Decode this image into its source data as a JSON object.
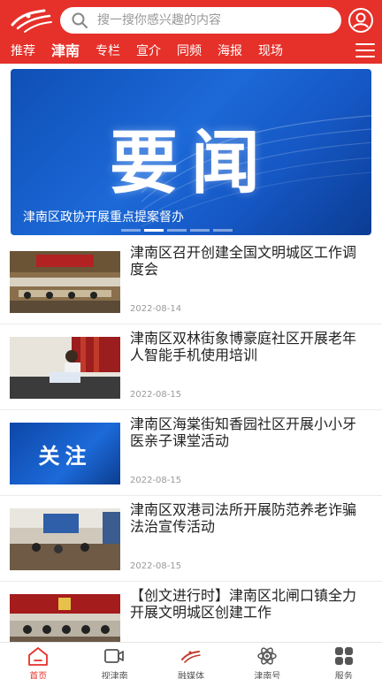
{
  "colors": {
    "brand": "#e5312a",
    "banner": "#1557c4"
  },
  "search": {
    "placeholder": "搜一搜你感兴趣的内容"
  },
  "nav": {
    "tabs": [
      {
        "label": "推荐",
        "active": false
      },
      {
        "label": "津南",
        "active": true
      },
      {
        "label": "专栏",
        "active": false
      },
      {
        "label": "宣介",
        "active": false
      },
      {
        "label": "同频",
        "active": false
      },
      {
        "label": "海报",
        "active": false
      },
      {
        "label": "现场",
        "active": false
      }
    ]
  },
  "banner": {
    "image_text": "要闻",
    "caption": "津南区政协开展重点提案督办",
    "slide_index": 1,
    "slide_count": 5
  },
  "news": [
    {
      "title": "津南区召开创建全国文明城区工作调度会",
      "date": "2022-08-14",
      "thumb_text": ""
    },
    {
      "title": "津南区双林街象博豪庭社区开展老年人智能手机使用培训",
      "date": "2022-08-15",
      "thumb_text": ""
    },
    {
      "title": "津南区海棠街知香园社区开展小小牙医亲子课堂活动",
      "date": "2022-08-15",
      "thumb_text": "关注"
    },
    {
      "title": "津南区双港司法所开展防范养老诈骗法治宣传活动",
      "date": "2022-08-15",
      "thumb_text": ""
    },
    {
      "title": "【创文进行时】津南区北闸口镇全力开展文明城区创建工作",
      "date": "",
      "thumb_text": ""
    }
  ],
  "tabbar": {
    "items": [
      {
        "label": "首页",
        "icon": "home-icon",
        "active": true
      },
      {
        "label": "视津南",
        "icon": "video-icon",
        "active": false
      },
      {
        "label": "融媒体",
        "icon": "media-logo-icon",
        "active": false
      },
      {
        "label": "津南号",
        "icon": "atom-icon",
        "active": false
      },
      {
        "label": "服务",
        "icon": "grid-icon",
        "active": false
      }
    ]
  }
}
